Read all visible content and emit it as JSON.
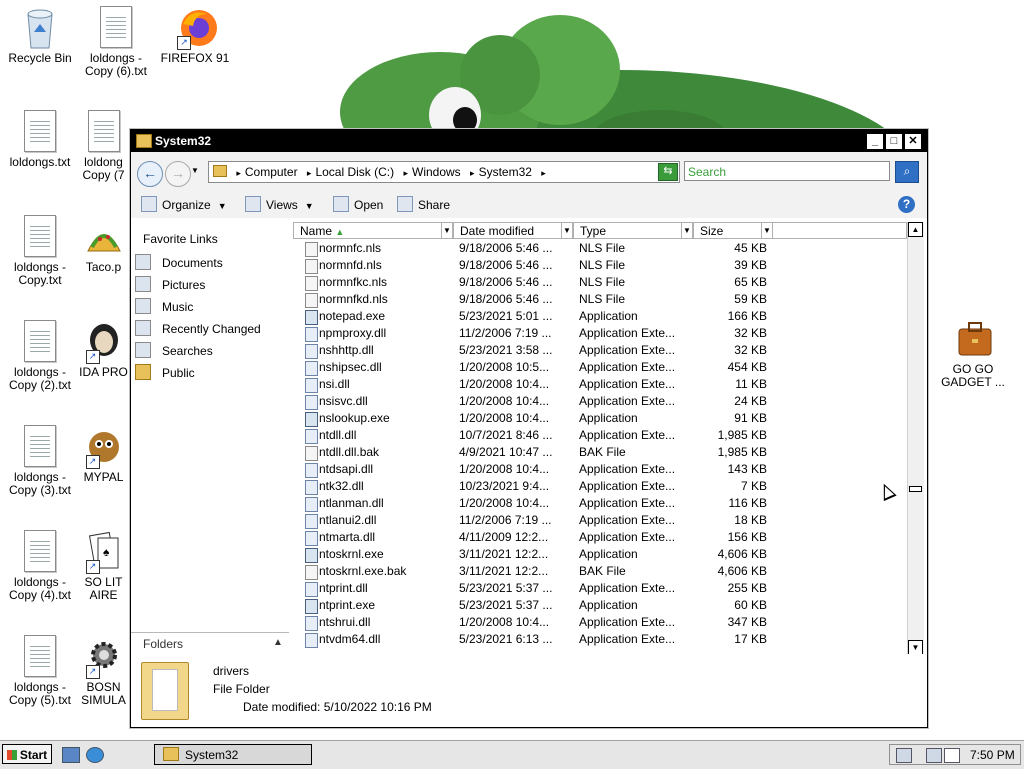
{
  "desktop": {
    "icons": [
      {
        "label": "Recycle Bin",
        "icon": "recycle-bin-icon"
      },
      {
        "label": "loldongs - Copy (6).txt",
        "icon": "text-file-icon"
      },
      {
        "label": "FIREFOX 91",
        "icon": "firefox-icon"
      },
      {
        "label": "loldongs.txt",
        "icon": "text-file-icon"
      },
      {
        "label": "loldong Copy (7",
        "icon": "text-file-icon"
      },
      {
        "label": "loldongs - Copy.txt",
        "icon": "text-file-icon"
      },
      {
        "label": "Taco.p",
        "icon": "taco-icon"
      },
      {
        "label": "loldongs - Copy (2).txt",
        "icon": "text-file-icon"
      },
      {
        "label": "IDA PRO",
        "icon": "ida-icon"
      },
      {
        "label": "loldongs - Copy (3).txt",
        "icon": "text-file-icon"
      },
      {
        "label": "MYPAL",
        "icon": "mypal-icon"
      },
      {
        "label": "loldongs - Copy (4).txt",
        "icon": "text-file-icon"
      },
      {
        "label": "SO LIT AIRE",
        "icon": "cards-icon"
      },
      {
        "label": "loldongs - Copy (5).txt",
        "icon": "text-file-icon"
      },
      {
        "label": "BOSN SIMULA",
        "icon": "gear-icon"
      },
      {
        "label": "GO GO GADGET ...",
        "icon": "briefcase-icon"
      }
    ]
  },
  "window": {
    "title": "System32",
    "breadcrumbs": [
      "Computer",
      "Local Disk (C:)",
      "Windows",
      "System32"
    ],
    "search_placeholder": "Search",
    "commands": {
      "organize": "Organize",
      "views": "Views",
      "open": "Open",
      "share": "Share"
    },
    "nav": {
      "header": "Favorite Links",
      "items": [
        "Documents",
        "Pictures",
        "Music",
        "Recently Changed",
        "Searches",
        "Public"
      ],
      "folders_label": "Folders"
    },
    "columns": {
      "name": "Name",
      "date": "Date modified",
      "type": "Type",
      "size": "Size"
    },
    "files": [
      {
        "name": "normnfc.nls",
        "date": "9/18/2006 5:46 ...",
        "type": "NLS File",
        "size": "45 KB",
        "kind": "file"
      },
      {
        "name": "normnfd.nls",
        "date": "9/18/2006 5:46 ...",
        "type": "NLS File",
        "size": "39 KB",
        "kind": "file"
      },
      {
        "name": "normnfkc.nls",
        "date": "9/18/2006 5:46 ...",
        "type": "NLS File",
        "size": "65 KB",
        "kind": "file"
      },
      {
        "name": "normnfkd.nls",
        "date": "9/18/2006 5:46 ...",
        "type": "NLS File",
        "size": "59 KB",
        "kind": "file"
      },
      {
        "name": "notepad.exe",
        "date": "5/23/2021 5:01 ...",
        "type": "Application",
        "size": "166 KB",
        "kind": "exe"
      },
      {
        "name": "npmproxy.dll",
        "date": "11/2/2006 7:19 ...",
        "type": "Application Exte...",
        "size": "32 KB",
        "kind": "dll"
      },
      {
        "name": "nshhttp.dll",
        "date": "5/23/2021 3:58 ...",
        "type": "Application Exte...",
        "size": "32 KB",
        "kind": "dll"
      },
      {
        "name": "nshipsec.dll",
        "date": "1/20/2008 10:5...",
        "type": "Application Exte...",
        "size": "454 KB",
        "kind": "dll"
      },
      {
        "name": "nsi.dll",
        "date": "1/20/2008 10:4...",
        "type": "Application Exte...",
        "size": "11 KB",
        "kind": "dll"
      },
      {
        "name": "nsisvc.dll",
        "date": "1/20/2008 10:4...",
        "type": "Application Exte...",
        "size": "24 KB",
        "kind": "dll"
      },
      {
        "name": "nslookup.exe",
        "date": "1/20/2008 10:4...",
        "type": "Application",
        "size": "91 KB",
        "kind": "exe"
      },
      {
        "name": "ntdll.dll",
        "date": "10/7/2021 8:46 ...",
        "type": "Application Exte...",
        "size": "1,985 KB",
        "kind": "dll"
      },
      {
        "name": "ntdll.dll.bak",
        "date": "4/9/2021 10:47 ...",
        "type": "BAK File",
        "size": "1,985 KB",
        "kind": "file"
      },
      {
        "name": "ntdsapi.dll",
        "date": "1/20/2008 10:4...",
        "type": "Application Exte...",
        "size": "143 KB",
        "kind": "dll"
      },
      {
        "name": "ntk32.dll",
        "date": "10/23/2021 9:4...",
        "type": "Application Exte...",
        "size": "7 KB",
        "kind": "dll"
      },
      {
        "name": "ntlanman.dll",
        "date": "1/20/2008 10:4...",
        "type": "Application Exte...",
        "size": "116 KB",
        "kind": "dll"
      },
      {
        "name": "ntlanui2.dll",
        "date": "11/2/2006 7:19 ...",
        "type": "Application Exte...",
        "size": "18 KB",
        "kind": "dll"
      },
      {
        "name": "ntmarta.dll",
        "date": "4/11/2009 12:2...",
        "type": "Application Exte...",
        "size": "156 KB",
        "kind": "dll"
      },
      {
        "name": "ntoskrnl.exe",
        "date": "3/11/2021 12:2...",
        "type": "Application",
        "size": "4,606 KB",
        "kind": "exe"
      },
      {
        "name": "ntoskrnl.exe.bak",
        "date": "3/11/2021 12:2...",
        "type": "BAK File",
        "size": "4,606 KB",
        "kind": "file"
      },
      {
        "name": "ntprint.dll",
        "date": "5/23/2021 5:37 ...",
        "type": "Application Exte...",
        "size": "255 KB",
        "kind": "dll"
      },
      {
        "name": "ntprint.exe",
        "date": "5/23/2021 5:37 ...",
        "type": "Application",
        "size": "60 KB",
        "kind": "exe"
      },
      {
        "name": "ntshrui.dll",
        "date": "1/20/2008 10:4...",
        "type": "Application Exte...",
        "size": "347 KB",
        "kind": "dll"
      },
      {
        "name": "ntvdm64.dll",
        "date": "5/23/2021 6:13 ...",
        "type": "Application Exte...",
        "size": "17 KB",
        "kind": "dll"
      }
    ],
    "details": {
      "name": "drivers",
      "kind": "File Folder",
      "modified": "Date modified: 5/10/2022 10:16 PM"
    }
  },
  "taskbar": {
    "start_label": "Start",
    "task_label": "System32",
    "clock": "7:50 PM"
  }
}
